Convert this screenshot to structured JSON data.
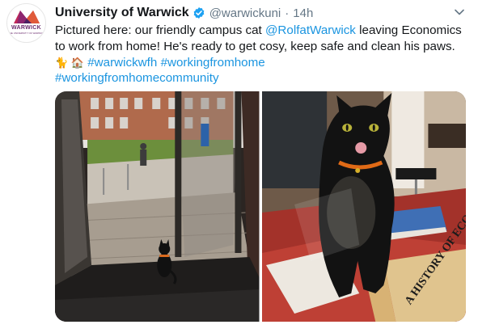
{
  "account": {
    "name": "University of Warwick",
    "handle": "@warwickuni",
    "separator": "·",
    "timestamp": "14h",
    "avatar_logo_text": "WARWICK",
    "avatar_logo_subtext": "THE UNIVERSITY OF WARWICK"
  },
  "tweet": {
    "text_part1": "Pictured here: our friendly campus cat ",
    "mention": "@RolfatWarwick",
    "text_part2": " leaving Economics to work from home! He's ready to get cosy, keep safe and clean his paws. ",
    "emoji": "🐈 🏠",
    "hashtag1": "#warwickwfh",
    "hashtag2": "#workingfromhome",
    "hashtag3": "#workingfromhomecommunity"
  },
  "media": {
    "photo_left_label": "Cat walking out through open glass doors",
    "photo_right_label": "Black cat licking its lips on a desk with books",
    "book_title": "A HISTORY OF ECONOMIC"
  },
  "icons": {
    "verified": "verified-badge-icon",
    "caret": "chevron-down-icon"
  },
  "colors": {
    "link": "#1b95e0",
    "verified": "#1da1f2",
    "secondary_text": "#657786",
    "brand": "#6b2c6e"
  }
}
